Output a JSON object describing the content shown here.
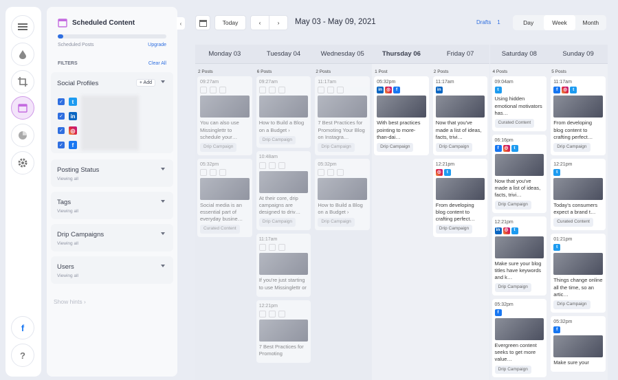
{
  "rail": {
    "items": [
      "list-icon",
      "drop-icon",
      "crop-icon",
      "calendar-icon",
      "pie-chart-icon",
      "gear-icon"
    ],
    "bottom": [
      "facebook-icon",
      "help-icon"
    ]
  },
  "panel": {
    "title": "Scheduled Content",
    "posts_progress": 0.05,
    "scheduled_label": "Scheduled Posts",
    "upgrade": "Upgrade",
    "filters": "FILTERS",
    "clear_all": "Clear All",
    "social_profiles": "Social Profiles",
    "add": "+ Add",
    "sections": [
      {
        "title": "Posting Status",
        "sub": "Viewing all"
      },
      {
        "title": "Tags",
        "sub": "Viewing all"
      },
      {
        "title": "Drip Campaigns",
        "sub": "Viewing all"
      },
      {
        "title": "Users",
        "sub": "Viewing all"
      }
    ],
    "show_hints": "Show hints"
  },
  "toolbar": {
    "today": "Today",
    "prev": "‹",
    "next": "›",
    "range": "May 03 - May 09, 2021",
    "drafts": "Drafts",
    "drafts_count": "1",
    "collapse": "‹"
  },
  "view_tabs": [
    {
      "label": "Day",
      "active": false
    },
    {
      "label": "Week",
      "active": true
    },
    {
      "label": "Month",
      "active": false
    }
  ],
  "days": [
    {
      "name": "Monday 03",
      "count": "2 Posts",
      "past": true,
      "cards": [
        {
          "time": "09:27am",
          "icons": [],
          "thumb": true,
          "text": "You can also use Missinglettr to schedule your…",
          "tag": "Drip Campaign"
        },
        {
          "time": "05:32pm",
          "icons": [],
          "thumb": true,
          "text": "Social media is an essential part of everyday busine…",
          "tag": "Curated Content"
        }
      ]
    },
    {
      "name": "Tuesday 04",
      "count": "6 Posts",
      "past": true,
      "cards": [
        {
          "time": "09:27am",
          "icons": [],
          "thumb": true,
          "text": "How to Build a Blog on a Budget ›",
          "tag": "Drip Campaign"
        },
        {
          "time": "10:48am",
          "icons": [],
          "thumb": true,
          "text": "At their core, drip campaigns are designed to driv…",
          "tag": "Drip Campaign"
        },
        {
          "time": "11:17am",
          "icons": [],
          "thumb": true,
          "text": "If you're just starting to use Missinglettr or",
          "tag": ""
        },
        {
          "time": "12:21pm",
          "icons": [],
          "thumb": true,
          "text": "7 Best Practices for Promoting",
          "tag": ""
        }
      ]
    },
    {
      "name": "Wednesday 05",
      "count": "2 Posts",
      "past": true,
      "cards": [
        {
          "time": "11:17am",
          "icons": [],
          "thumb": true,
          "text": "7 Best Practices for Promoting Your Blog on Instagra…",
          "tag": "Drip Campaign"
        },
        {
          "time": "05:32pm",
          "icons": [],
          "thumb": true,
          "text": "How to Build a Blog on a Budget ›",
          "tag": "Drip Campaign"
        }
      ]
    },
    {
      "name": "Thursday 06",
      "count": "1 Post",
      "past": false,
      "today": true,
      "cards": [
        {
          "time": "05:32pm",
          "icons": [
            "li",
            "ig",
            "fb"
          ],
          "thumb": true,
          "text": "With best practices pointing to more-than-dai…",
          "tag": "Drip Campaign"
        }
      ]
    },
    {
      "name": "Friday 07",
      "count": "2 Posts",
      "past": false,
      "cards": [
        {
          "time": "11:17am",
          "icons": [
            "li"
          ],
          "thumb": true,
          "text": "Now that you've made a list of ideas, facts, trivi…",
          "tag": "Drip Campaign"
        },
        {
          "time": "12:21pm",
          "icons": [
            "ig",
            "tw"
          ],
          "thumb": true,
          "text": "From developing blog content to crafting perfect…",
          "tag": "Drip Campaign"
        }
      ]
    },
    {
      "name": "Saturday 08",
      "count": "4 Posts",
      "past": false,
      "cards": [
        {
          "time": "09:04am",
          "icons": [
            "tw"
          ],
          "thumb": false,
          "text": "Using hidden emotional motivators has…",
          "tag": "Curated Content"
        },
        {
          "time": "06:16pm",
          "icons": [
            "fb",
            "ig",
            "tw"
          ],
          "thumb": true,
          "text": "Now that you've made a list of ideas, facts, trivi…",
          "tag": "Drip Campaign"
        },
        {
          "time": "12:21pm",
          "icons": [
            "li",
            "ig",
            "tw"
          ],
          "thumb": true,
          "text": "Make sure your blog titles have keywords and k…",
          "tag": "Drip Campaign"
        },
        {
          "time": "05:32pm",
          "icons": [
            "fb"
          ],
          "thumb": true,
          "text": "Evergreen content seeks to get more value…",
          "tag": "Drip Campaign"
        }
      ]
    },
    {
      "name": "Sunday 09",
      "count": "5 Posts",
      "past": false,
      "cards": [
        {
          "time": "11:17am",
          "icons": [
            "fb",
            "ig",
            "tw"
          ],
          "thumb": true,
          "text": "From developing blog content to crafting perfect…",
          "tag": "Drip Campaign"
        },
        {
          "time": "12:21pm",
          "icons": [
            "tw"
          ],
          "thumb": true,
          "text": "Today's consumers expect a brand t…",
          "tag": "Curated Content"
        },
        {
          "time": "01:21pm",
          "icons": [
            "tw"
          ],
          "thumb": true,
          "text": "Things change online all the time, so an artic…",
          "tag": "Drip Campaign"
        },
        {
          "time": "05:32pm",
          "icons": [
            "fb"
          ],
          "thumb": true,
          "text": "Make sure your",
          "tag": ""
        }
      ]
    }
  ]
}
